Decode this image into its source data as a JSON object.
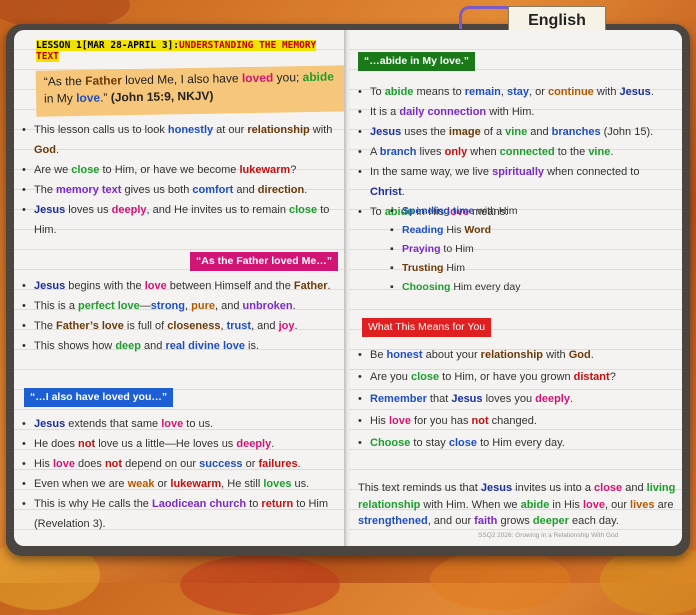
{
  "tab": "English",
  "lesson": {
    "prefix": "LESSON 1[MAR 28-APRIL 3]:",
    "title": "UNDERSTANDING THE MEMORY TEXT"
  },
  "verse": {
    "ref": "(John 15:9, NKJV)"
  },
  "left_paragraphs": [
    "This lesson calls us to look honestly at our relationship with God.",
    "Are we close to Him, or have we become lukewarm?",
    "The memory text gives us both comfort and direction.",
    "Jesus loves us deeply, and He invites us to remain close to Him."
  ],
  "heading_father": "“As the Father loved Me…”",
  "father_points": [
    "Jesus begins with the love between Himself and the Father.",
    "This is a perfect love—strong, pure, and unbroken.",
    "The Father’s love is full of closeness, trust, and joy.",
    "This shows how deep and real divine love is."
  ],
  "heading_loved": "“…I also have loved you…”",
  "loved_points": [
    "Jesus extends that same love to us.",
    "He does not love us a little—He loves us deeply.",
    "His love does not depend on our success or failures.",
    "Even when we are weak or lukewarm, He still loves us.",
    "This is why He calls the Laodicean church to return to Him (Revelation 3)."
  ],
  "heading_abide": "“…abide in My love.”",
  "abide_points": [
    "To abide means to remain, stay, or continue with Jesus.",
    "It is a daily connection with Him.",
    "Jesus uses the image of a vine and branches (John 15).",
    "A branch lives only when connected to the vine.",
    "In the same way, we live spiritually when connected to Christ.",
    "To abide in His love means:"
  ],
  "abide_sub": [
    "Spending time with Him",
    "Reading His Word",
    "Praying to Him",
    "Trusting Him",
    "Choosing Him every day"
  ],
  "heading_means": "What This Means for You",
  "means_points": [
    "Be honest about your relationship with God.",
    "Are you close to Him, or have you grown distant?",
    "Remember that Jesus loves you deeply.",
    "His love for you has not changed.",
    "Choose to stay close to Him every day."
  ],
  "closing": "This text reminds us that Jesus invites us into a close and living relationship with Him. When we abide in His love, our lives are strengthened, and our faith grows deeper each day.",
  "footer": "SSQ2 2026: Growing in a Relationship With God",
  "colors": {
    "heading_father_bg": "#d11575",
    "heading_loved_bg": "#1f5fd4",
    "heading_abide_bg": "#1a7a1a",
    "heading_means_bg": "#e02020",
    "verse_bg": "#f6c77a",
    "highlight": "#f2e200"
  }
}
